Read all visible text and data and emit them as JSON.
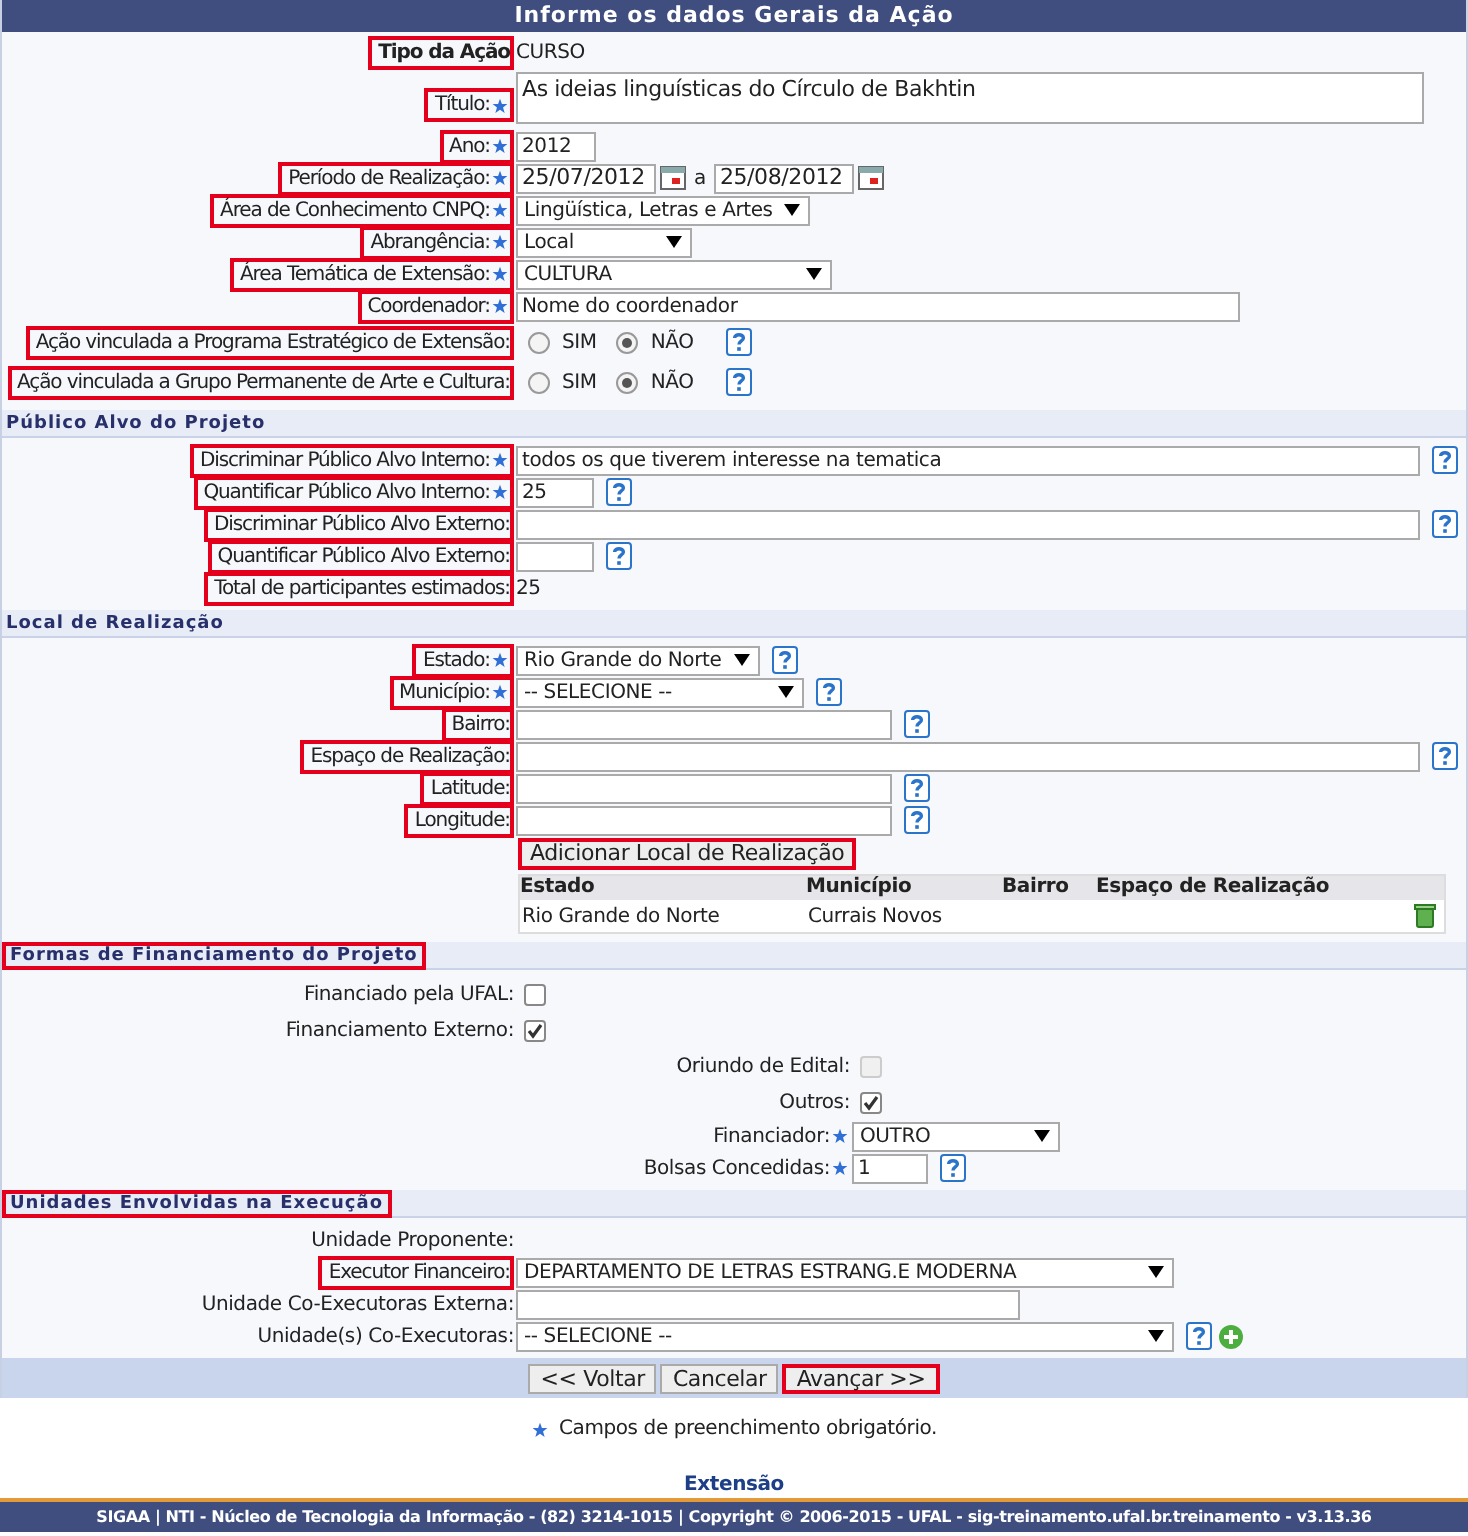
{
  "header": {
    "title": "Informe os dados Gerais da Ação"
  },
  "sections": [
    {
      "rows": [
        {
          "kind": "title_value",
          "label": "Tipo da Ação",
          "highlighted": true,
          "required": false,
          "value": "CURSO"
        },
        {
          "kind": "textarea",
          "label": "Título:",
          "highlighted": true,
          "required": true,
          "value": "As ideias linguísticas do Círculo de Bakhtin"
        },
        {
          "kind": "input",
          "label": "Ano:",
          "highlighted": true,
          "required": true,
          "value": "2012"
        },
        {
          "kind": "date_range",
          "label": "Período de Realização:",
          "highlighted": true,
          "required": true,
          "from": "25/07/2012",
          "separator": "a",
          "to": "25/08/2012"
        },
        {
          "kind": "select",
          "label": "Área de Conhecimento CNPQ:",
          "highlighted": true,
          "required": true,
          "value": "Lingüística, Letras e Artes"
        },
        {
          "kind": "select",
          "label": "Abrangência:",
          "highlighted": true,
          "required": true,
          "value": "Local"
        },
        {
          "kind": "select",
          "label": "Área Temática de Extensão:",
          "highlighted": true,
          "required": true,
          "value": "CULTURA"
        },
        {
          "kind": "input",
          "label": "Coordenador:",
          "highlighted": true,
          "required": true,
          "value": "Nome do coordenador"
        },
        {
          "kind": "radio",
          "label": "Ação vinculada a Programa Estratégico de Extensão:",
          "highlighted": true,
          "required": false,
          "help": true,
          "options": [
            {
              "label": "SIM",
              "selected": false
            },
            {
              "label": "NÃO",
              "selected": true
            }
          ]
        },
        {
          "kind": "radio",
          "label": "Ação vinculada a Grupo Permanente de Arte e Cultura:",
          "highlighted": true,
          "required": false,
          "help": true,
          "options": [
            {
              "label": "SIM",
              "selected": false
            },
            {
              "label": "NÃO",
              "selected": true
            }
          ]
        }
      ]
    },
    {
      "title": "Público Alvo do Projeto",
      "highlighted": false,
      "rows": [
        {
          "kind": "input",
          "label": "Discriminar Público Alvo Interno:",
          "highlighted": true,
          "required": true,
          "help": true,
          "value": "todos os que tiverem interesse na tematica"
        },
        {
          "kind": "input",
          "label": "Quantificar Público Alvo Interno:",
          "highlighted": true,
          "required": true,
          "help": true,
          "value": "25"
        },
        {
          "kind": "input",
          "label": "Discriminar Público Alvo Externo:",
          "highlighted": true,
          "required": false,
          "help": true
        },
        {
          "kind": "input",
          "label": "Quantificar Público Alvo Externo:",
          "highlighted": true,
          "required": false,
          "help": true
        },
        {
          "kind": "text",
          "label": "Total de participantes estimados:",
          "highlighted": true,
          "required": false,
          "value": "25"
        }
      ]
    },
    {
      "title": "Local de Realização",
      "highlighted": false,
      "rows": [
        {
          "kind": "select",
          "label": "Estado:",
          "highlighted": true,
          "required": true,
          "help": true,
          "value": "Rio Grande do Norte"
        },
        {
          "kind": "select",
          "label": "Município:",
          "highlighted": true,
          "required": true,
          "help": true,
          "value": "-- SELECIONE --"
        },
        {
          "kind": "input",
          "label": "Bairro:",
          "highlighted": true,
          "required": false,
          "help": true
        },
        {
          "kind": "input",
          "label": "Espaço de Realização:",
          "highlighted": true,
          "required": false,
          "help": true
        },
        {
          "kind": "input",
          "label": "Latitude:",
          "highlighted": true,
          "required": false,
          "help": true
        },
        {
          "kind": "input",
          "label": "Longitude:",
          "highlighted": true,
          "required": false,
          "help": true
        },
        {
          "kind": "button",
          "label": "Adicionar Local de Realização",
          "highlighted": true
        },
        {
          "kind": "table",
          "columns": [
            "Estado",
            "Município",
            "Bairro",
            "Espaço de Realização"
          ],
          "rows": [
            {
              "cells": [
                "Rio Grande do Norte",
                "Currais Novos"
              ]
            }
          ]
        }
      ]
    },
    {
      "title": "Formas de Financiamento do Projeto",
      "highlighted": true,
      "rows": [
        {
          "kind": "checkbox",
          "label": "Financiado pela UFAL:",
          "highlighted": false,
          "required": false,
          "checked": false,
          "disabled": false
        },
        {
          "kind": "checkbox",
          "label": "Financiamento Externo:",
          "highlighted": false,
          "required": false,
          "checked": true,
          "disabled": false,
          "children": [
            {
              "kind": "checkbox",
              "label": "Oriundo de Edital:",
              "highlighted": false,
              "required": false,
              "checked": false,
              "disabled": true
            },
            {
              "kind": "checkbox",
              "label": "Outros:",
              "highlighted": false,
              "required": false,
              "checked": true,
              "disabled": false
            },
            {
              "kind": "select",
              "label": "Financiador:",
              "highlighted": false,
              "required": true,
              "value": "OUTRO"
            },
            {
              "kind": "input",
              "label": "Bolsas Concedidas:",
              "highlighted": false,
              "required": true,
              "help": true,
              "value": "1"
            }
          ]
        }
      ]
    },
    {
      "title": "Unidades Envolvidas na Execução",
      "highlighted": true,
      "rows": [
        {
          "kind": "label",
          "label": "Unidade Proponente:",
          "highlighted": false,
          "required": false
        },
        {
          "kind": "select",
          "label": "Executor Financeiro:",
          "highlighted": true,
          "required": false,
          "value": "DEPARTAMENTO DE LETRAS ESTRANG.E MODERNA"
        },
        {
          "kind": "input",
          "label": "Unidade Co-Executoras Externa:",
          "highlighted": false,
          "required": false
        },
        {
          "kind": "select",
          "label": "Unidade(s) Co-Executoras:",
          "highlighted": false,
          "required": false,
          "help": true,
          "add": true,
          "value": "-- SELECIONE --"
        }
      ]
    }
  ],
  "buttons": [
    {
      "label": "<< Voltar",
      "highlighted": false
    },
    {
      "label": "Cancelar",
      "highlighted": false
    },
    {
      "label": "Avançar >>",
      "highlighted": true
    }
  ],
  "note": "Campos de preenchimento obrigatório.",
  "module": "Extensão",
  "footer": "SIGAA | NTI - Núcleo de Tecnologia da Informação - (82) 3214-1015 | Copyright © 2006-2015 - UFAL - sig-treinamento.ufal.br.treinamento - v3.13.36"
}
